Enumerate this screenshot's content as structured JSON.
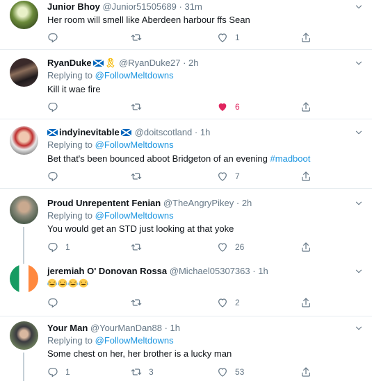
{
  "tweets": [
    {
      "name": "Junior Bhoy",
      "handle": "@Junior51505689",
      "sep": "·",
      "time": "31m",
      "replying_prefix": "",
      "replying_to": "",
      "text": "Her room will smell like Aberdeen harbour ffs Sean",
      "reply_count": "",
      "retweet_count": "",
      "like_count": "1",
      "liked": false
    },
    {
      "name": "RyanDuke",
      "handle": "@RyanDuke27",
      "sep": "·",
      "time": "2h",
      "replying_prefix": "Replying to",
      "replying_to": "@FollowMeltdowns",
      "text": "Kill it wae fire",
      "reply_count": "",
      "retweet_count": "",
      "like_count": "6",
      "liked": true
    },
    {
      "name": "indyinevitable",
      "handle": "@doitscotland",
      "sep": "·",
      "time": "1h",
      "replying_prefix": "Replying to",
      "replying_to": "@FollowMeltdowns",
      "text": "Bet that's been bounced aboot Bridgeton of an evening",
      "hashtag": "#madboot",
      "reply_count": "",
      "retweet_count": "",
      "like_count": "7",
      "liked": false
    },
    {
      "name": "Proud Unrepentent Fenian",
      "handle": "@TheAngryPikey",
      "sep": "·",
      "time": "2h",
      "replying_prefix": "Replying to",
      "replying_to": "@FollowMeltdowns",
      "text": "You would get an STD just looking at that yoke",
      "reply_count": "1",
      "retweet_count": "",
      "like_count": "26",
      "liked": false
    },
    {
      "name": "jeremiah O' Donovan Rossa",
      "handle": "@Michael05307363",
      "sep": "·",
      "time": "1h",
      "replying_prefix": "",
      "replying_to": "",
      "text": "",
      "emoji_count": 4,
      "reply_count": "",
      "retweet_count": "",
      "like_count": "2",
      "liked": false
    },
    {
      "name": "Your Man",
      "handle": "@YourManDan88",
      "sep": "·",
      "time": "1h",
      "replying_prefix": "Replying to",
      "replying_to": "@FollowMeltdowns",
      "text": "Some chest on her, her brother is a lucky man",
      "reply_count": "1",
      "retweet_count": "3",
      "like_count": "53",
      "liked": false
    }
  ],
  "colors": {
    "link": "#1b95e0",
    "muted": "#657786",
    "like": "#e0245e",
    "border": "#e6ecf0"
  },
  "icons": {
    "reply": "reply-icon",
    "retweet": "retweet-icon",
    "like": "heart-icon",
    "share": "share-icon",
    "more": "chevron-down-icon"
  }
}
